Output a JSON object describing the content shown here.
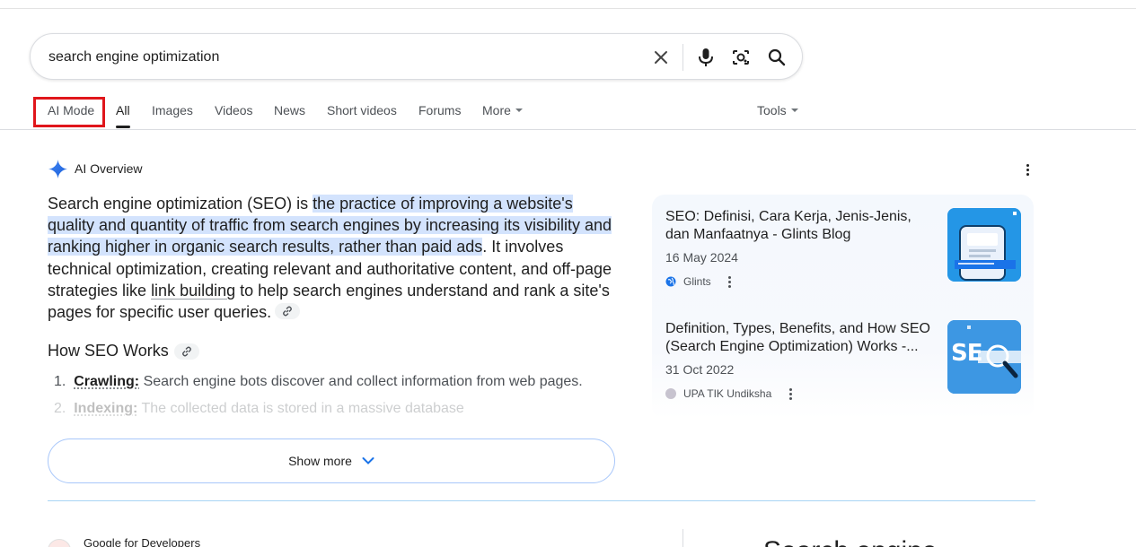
{
  "search": {
    "query": "search engine optimization"
  },
  "tabs": [
    {
      "label": "AI Mode"
    },
    {
      "label": "All"
    },
    {
      "label": "Images"
    },
    {
      "label": "Videos"
    },
    {
      "label": "News"
    },
    {
      "label": "Short videos"
    },
    {
      "label": "Forums"
    },
    {
      "label": "More"
    }
  ],
  "tools_label": "Tools",
  "ai_overview": {
    "title": "AI Overview",
    "intro_pre": "Search engine optimization (SEO) is ",
    "intro_highlight": "the practice of improving a website's quality and quantity of traffic from search engines by increasing its visibility and ranking higher in organic search results, rather than paid ads",
    "intro_mid": ". It involves technical optimization, creating relevant and authoritative content, and off-page strategies like ",
    "intro_link": "link building",
    "intro_post": " to help search engines understand and rank a site's pages for specific user queries.",
    "section_heading": "How SEO Works",
    "steps": [
      {
        "num": "1.",
        "term": "Crawling:",
        "text": " Search engine bots discover and collect information from web pages."
      },
      {
        "num": "2.",
        "term": "Indexing:",
        "text": " The collected data is stored in a massive database"
      }
    ],
    "show_more_label": "Show more"
  },
  "sources": [
    {
      "title": "SEO: Definisi, Cara Kerja, Jenis-Jenis, dan Manfaatnya - Glints Blog",
      "date": "16 May 2024",
      "site": "Glints"
    },
    {
      "title": "Definition, Types, Benefits, and How SEO (Search Engine Optimization) Works -...",
      "date": "31 Oct 2022",
      "site": "UPA TIK Undiksha",
      "thumb_text": "SE"
    }
  ],
  "bottom": {
    "site_name": "Google for Developers",
    "big_text": "Search engine"
  },
  "colors": {
    "highlight": "#d3e3fd",
    "ai_mode_outline": "#e0161b",
    "accent_blue": "#1a73e8"
  }
}
